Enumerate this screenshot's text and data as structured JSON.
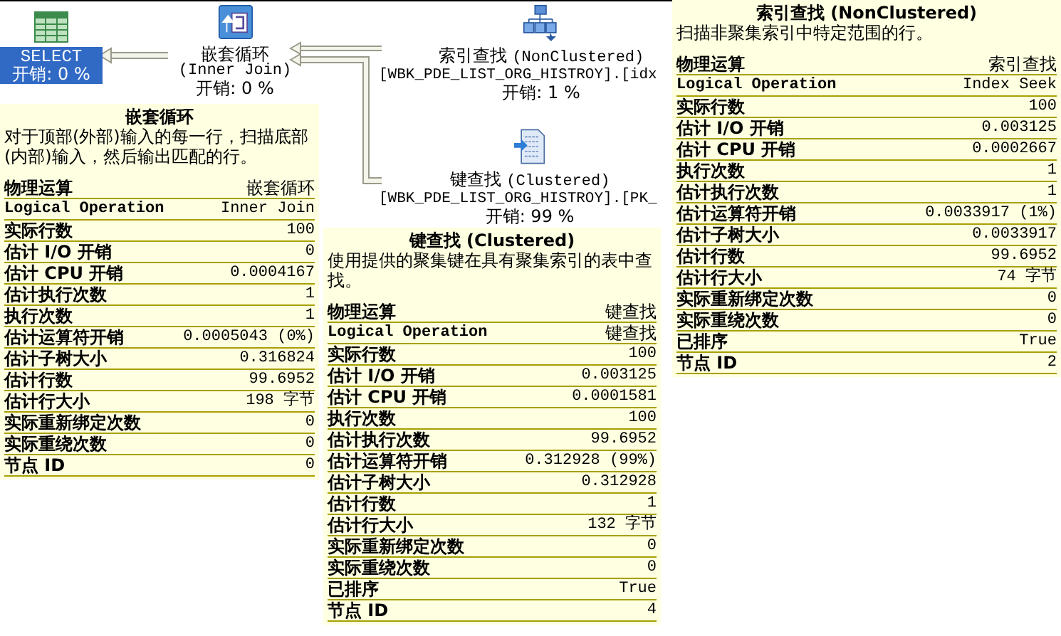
{
  "nodes": [
    {
      "kind": "select",
      "label": "SELECT",
      "cost": "开销: 0 %",
      "selected": true
    },
    {
      "kind": "nested-loop",
      "label": "嵌套循环",
      "subtitle": "(Inner Join)",
      "cost": "开销: 0 %",
      "selected": false
    },
    {
      "kind": "index-seek",
      "label": "索引查找",
      "subtitle": "(NonClustered)",
      "object": "[WBK_PDE_LIST_ORG_HISTROY].[idx",
      "cost": "开销: 1 %",
      "selected": false
    },
    {
      "kind": "key-lookup",
      "label": "键查找",
      "subtitle": "(Clustered)",
      "object": "[WBK_PDE_LIST_ORG_HISTROY].[PK_",
      "cost": "开销: 99 %",
      "selected": false
    }
  ],
  "tooltips": [
    {
      "title": "嵌套循环",
      "description": "对于顶部(外部)输入的每一行，扫描底部(内部)输入，然后输出匹配的行。",
      "properties": [
        {
          "name": "物理运算",
          "value": "嵌套循环"
        },
        {
          "name": "Logical Operation",
          "value": "Inner Join"
        },
        {
          "name": "实际行数",
          "value": "100"
        },
        {
          "name": "估计 I/O 开销",
          "value": "0"
        },
        {
          "name": "估计 CPU 开销",
          "value": "0.0004167"
        },
        {
          "name": "估计执行次数",
          "value": "1"
        },
        {
          "name": "执行次数",
          "value": "1"
        },
        {
          "name": "估计运算符开销",
          "value": "0.0005043 (0%)"
        },
        {
          "name": "估计子树大小",
          "value": "0.316824"
        },
        {
          "name": "估计行数",
          "value": "99.6952"
        },
        {
          "name": "估计行大小",
          "value": "198 字节"
        },
        {
          "name": "实际重新绑定次数",
          "value": "0"
        },
        {
          "name": "实际重绕次数",
          "value": "0"
        },
        {
          "name": "节点 ID",
          "value": "0"
        }
      ]
    },
    {
      "title": "键查找 (Clustered)",
      "description": "使用提供的聚集键在具有聚集索引的表中查找。",
      "properties": [
        {
          "name": "物理运算",
          "value": "键查找"
        },
        {
          "name": "Logical Operation",
          "value": "键查找"
        },
        {
          "name": "实际行数",
          "value": "100"
        },
        {
          "name": "估计 I/O 开销",
          "value": "0.003125"
        },
        {
          "name": "估计 CPU 开销",
          "value": "0.0001581"
        },
        {
          "name": "执行次数",
          "value": "100"
        },
        {
          "name": "估计执行次数",
          "value": "99.6952"
        },
        {
          "name": "估计运算符开销",
          "value": "0.312928 (99%)"
        },
        {
          "name": "估计子树大小",
          "value": "0.312928"
        },
        {
          "name": "估计行数",
          "value": "1"
        },
        {
          "name": "估计行大小",
          "value": "132 字节"
        },
        {
          "name": "实际重新绑定次数",
          "value": "0"
        },
        {
          "name": "实际重绕次数",
          "value": "0"
        },
        {
          "name": "已排序",
          "value": "True"
        },
        {
          "name": "节点 ID",
          "value": "4"
        }
      ]
    },
    {
      "title": "索引查找 (NonClustered)",
      "description": "扫描非聚集索引中特定范围的行。",
      "properties": [
        {
          "name": "物理运算",
          "value": "索引查找"
        },
        {
          "name": "Logical Operation",
          "value": "Index Seek"
        },
        {
          "name": "实际行数",
          "value": "100"
        },
        {
          "name": "估计 I/O 开销",
          "value": "0.003125"
        },
        {
          "name": "估计 CPU 开销",
          "value": "0.0002667"
        },
        {
          "name": "执行次数",
          "value": "1"
        },
        {
          "name": "估计执行次数",
          "value": "1"
        },
        {
          "name": "估计运算符开销",
          "value": "0.0033917 (1%)"
        },
        {
          "name": "估计子树大小",
          "value": "0.0033917"
        },
        {
          "name": "估计行数",
          "value": "99.6952"
        },
        {
          "name": "估计行大小",
          "value": "74 字节"
        },
        {
          "name": "实际重新绑定次数",
          "value": "0"
        },
        {
          "name": "实际重绕次数",
          "value": "0"
        },
        {
          "name": "已排序",
          "value": "True"
        },
        {
          "name": "节点 ID",
          "value": "2"
        }
      ]
    }
  ]
}
